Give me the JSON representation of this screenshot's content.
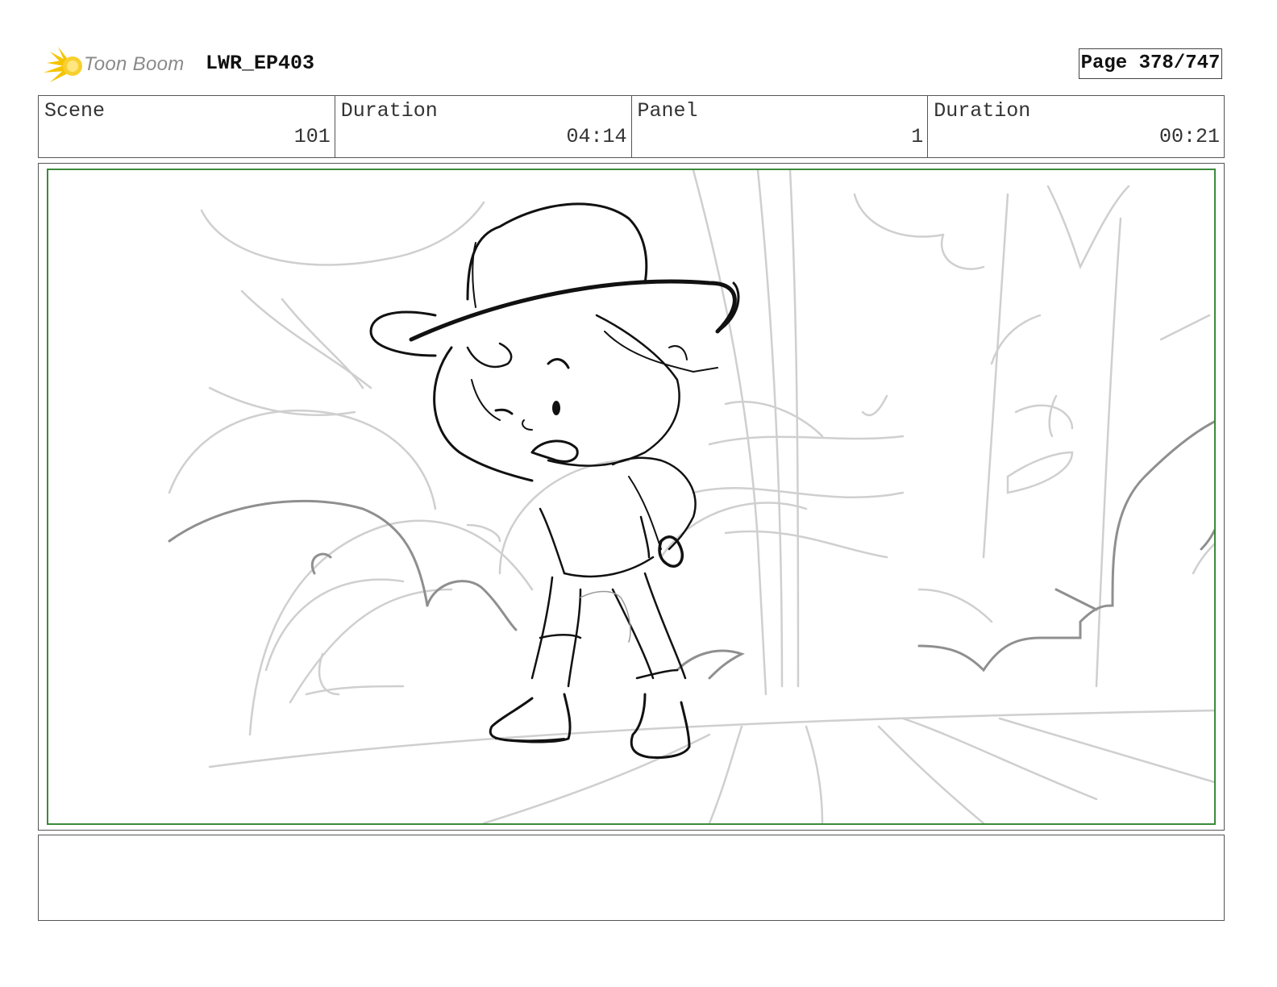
{
  "header": {
    "logo_text": "Toon Boom",
    "project_title": "LWR_EP403",
    "page_indicator": "Page 378/747"
  },
  "info": {
    "scene_label": "Scene",
    "scene_value": "101",
    "scene_duration_label": "Duration",
    "scene_duration_value": "04:14",
    "panel_label": "Panel",
    "panel_value": "1",
    "panel_duration_label": "Duration",
    "panel_duration_value": "00:21"
  },
  "panel": {
    "sketch_subject": "character-in-cap-in-forest",
    "safe_frame_color": "#3c8a3c"
  },
  "notes": {
    "text": ""
  },
  "colors": {
    "logo_burst": "#f5c400",
    "logo_text": "#8a8a8a",
    "border": "#555555"
  }
}
